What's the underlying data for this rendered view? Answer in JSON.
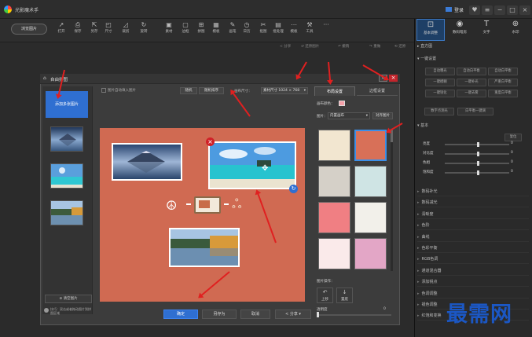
{
  "app": {
    "title": "光影魔术手",
    "login": "登录"
  },
  "window_controls": [
    "♥",
    "≡",
    "−",
    "□",
    "×"
  ],
  "toolbar": {
    "open_label": "浏览图片",
    "items": [
      {
        "icon": "↗",
        "label": "打开"
      },
      {
        "icon": "⎙",
        "label": "保存"
      },
      {
        "icon": "⇱",
        "label": "另存"
      },
      {
        "icon": "◰",
        "label": "尺寸"
      },
      {
        "icon": "◿",
        "label": "裁剪"
      },
      {
        "icon": "↻",
        "label": "旋转"
      },
      {
        "icon": "▣",
        "label": "素材"
      },
      {
        "icon": "▢",
        "label": "边框"
      },
      {
        "icon": "⊞",
        "label": "拼图"
      },
      {
        "icon": "▦",
        "label": "模板"
      },
      {
        "icon": "✎",
        "label": "画笔"
      },
      {
        "icon": "◷",
        "label": "日历"
      },
      {
        "icon": "✂",
        "label": "抠图"
      },
      {
        "icon": "▤",
        "label": "批处理"
      },
      {
        "icon": "⋯",
        "label": "模板"
      },
      {
        "icon": "⚒",
        "label": "工具"
      },
      {
        "icon": "···",
        "label": ""
      }
    ]
  },
  "subbar": {
    "items": [
      "< 分享",
      "↺ 还原图片",
      "↶ 撤销",
      "↷ 重做",
      "⟲ 还原"
    ]
  },
  "right_panel": {
    "tabs": [
      {
        "icon": "⊡",
        "label": "基本调整"
      },
      {
        "icon": "◉",
        "label": "数码暗房"
      },
      {
        "icon": "T",
        "label": "文字"
      },
      {
        "icon": "⊕",
        "label": "水印"
      }
    ],
    "histogram": "直方图",
    "quick_fix": {
      "title": "一键设置",
      "buttons": [
        "自动曝光",
        "自动白平衡",
        "自动白平衡",
        "一键模糊",
        "一键补光",
        "严重白平衡",
        "一键锐化",
        "一键去雾",
        "重度白平衡"
      ],
      "extra": [
        "数字点测光",
        "白平衡一键调"
      ]
    },
    "basic": {
      "title": "基本",
      "reset": "复位",
      "sliders": [
        {
          "label": "亮度",
          "value": "0",
          "level": 0.5
        },
        {
          "label": "对比度",
          "value": "0",
          "level": 0.5
        },
        {
          "label": "色相",
          "value": "0",
          "level": 0.5
        },
        {
          "label": "饱和度",
          "value": "0",
          "level": 0.5
        }
      ]
    },
    "accordion": [
      "数码补光",
      "数码减光",
      "清晰度",
      "色阶",
      "曲线",
      "色彩平衡",
      "RGB色调",
      "通道混合器",
      "添加锐点",
      "色调调整",
      "褪色调整",
      "红饱和变换"
    ]
  },
  "dialog": {
    "title": "自由拼图",
    "add_photo": "添加多张图片",
    "clear": "清空图片",
    "tip": "技巧：双击或者拖动图片到拼图区域",
    "auto_fill_label": "图片自动填入图片",
    "btn_random": "随机",
    "btn_sort": "随机排序",
    "canvas_size_label": "画布尺寸：",
    "canvas_size_value": "素材尺寸 1024 × 768",
    "tabs": {
      "layout": "布局设置",
      "border": "边框设置"
    },
    "bg_color_label": "画布颜色：",
    "image_label": "图片：",
    "image_select": "内置画布",
    "align_btn": "对齐图片",
    "image_ops": "图片操作：",
    "ops": [
      {
        "icon": "↶",
        "label": "上移"
      },
      {
        "icon": "↓",
        "label": "置底"
      }
    ],
    "opacity_label": "透明度",
    "opacity_value": "0",
    "bottom_buttons": [
      "确定",
      "另存为",
      "取消",
      "分享"
    ]
  },
  "swatches": [
    {
      "color": "#f2e6d0"
    },
    {
      "color": "#d87058"
    },
    {
      "color": "#d5d0c8"
    },
    {
      "color": "#cfe4e4"
    },
    {
      "color": "#f07f83"
    },
    {
      "color": "#f2f0ea"
    },
    {
      "color": "#faeaea"
    },
    {
      "color": "#e3a6c6"
    }
  ],
  "watermark": "最需网"
}
